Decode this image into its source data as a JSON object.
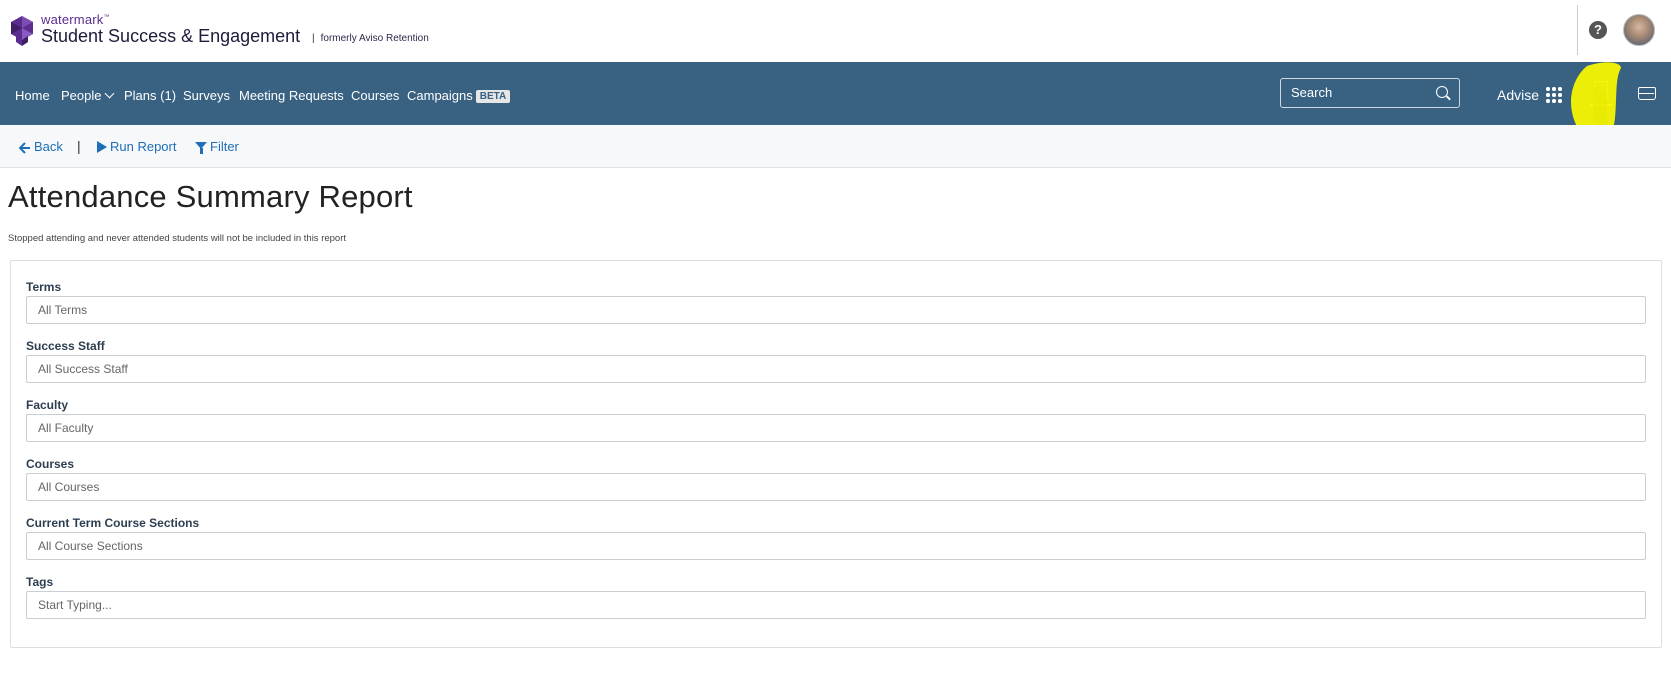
{
  "header": {
    "brand_small": "watermark",
    "brand_tm": "™",
    "brand_main": "Student Success & Engagement",
    "brand_pipe": "|",
    "brand_formerly": "formerly Aviso Retention",
    "help_symbol": "?"
  },
  "nav": {
    "items": [
      {
        "label": "Home"
      },
      {
        "label": "People"
      },
      {
        "label": "Plans (1)"
      },
      {
        "label": "Surveys"
      },
      {
        "label": "Meeting Requests"
      },
      {
        "label": "Courses"
      },
      {
        "label": "Campaigns"
      }
    ],
    "beta_badge": "BETA",
    "search_placeholder": "Search",
    "advise_label": "Advise",
    "highlight_color": "#f5f500"
  },
  "toolbar": {
    "back_label": "Back",
    "separator": "|",
    "run_report_label": "Run Report",
    "filter_label": "Filter"
  },
  "page": {
    "title": "Attendance Summary Report",
    "note": "Stopped attending and never attended students will not be included in this report"
  },
  "filters": [
    {
      "label": "Terms",
      "placeholder": "All Terms"
    },
    {
      "label": "Success Staff",
      "placeholder": "All Success Staff"
    },
    {
      "label": "Faculty",
      "placeholder": "All Faculty"
    },
    {
      "label": "Courses",
      "placeholder": "All Courses"
    },
    {
      "label": "Current Term Course Sections",
      "placeholder": "All Course Sections"
    },
    {
      "label": "Tags",
      "placeholder": "Start Typing..."
    }
  ],
  "colors": {
    "nav_bg": "#386182",
    "link": "#1f6fb8",
    "brand_purple": "#5b2d8e"
  }
}
